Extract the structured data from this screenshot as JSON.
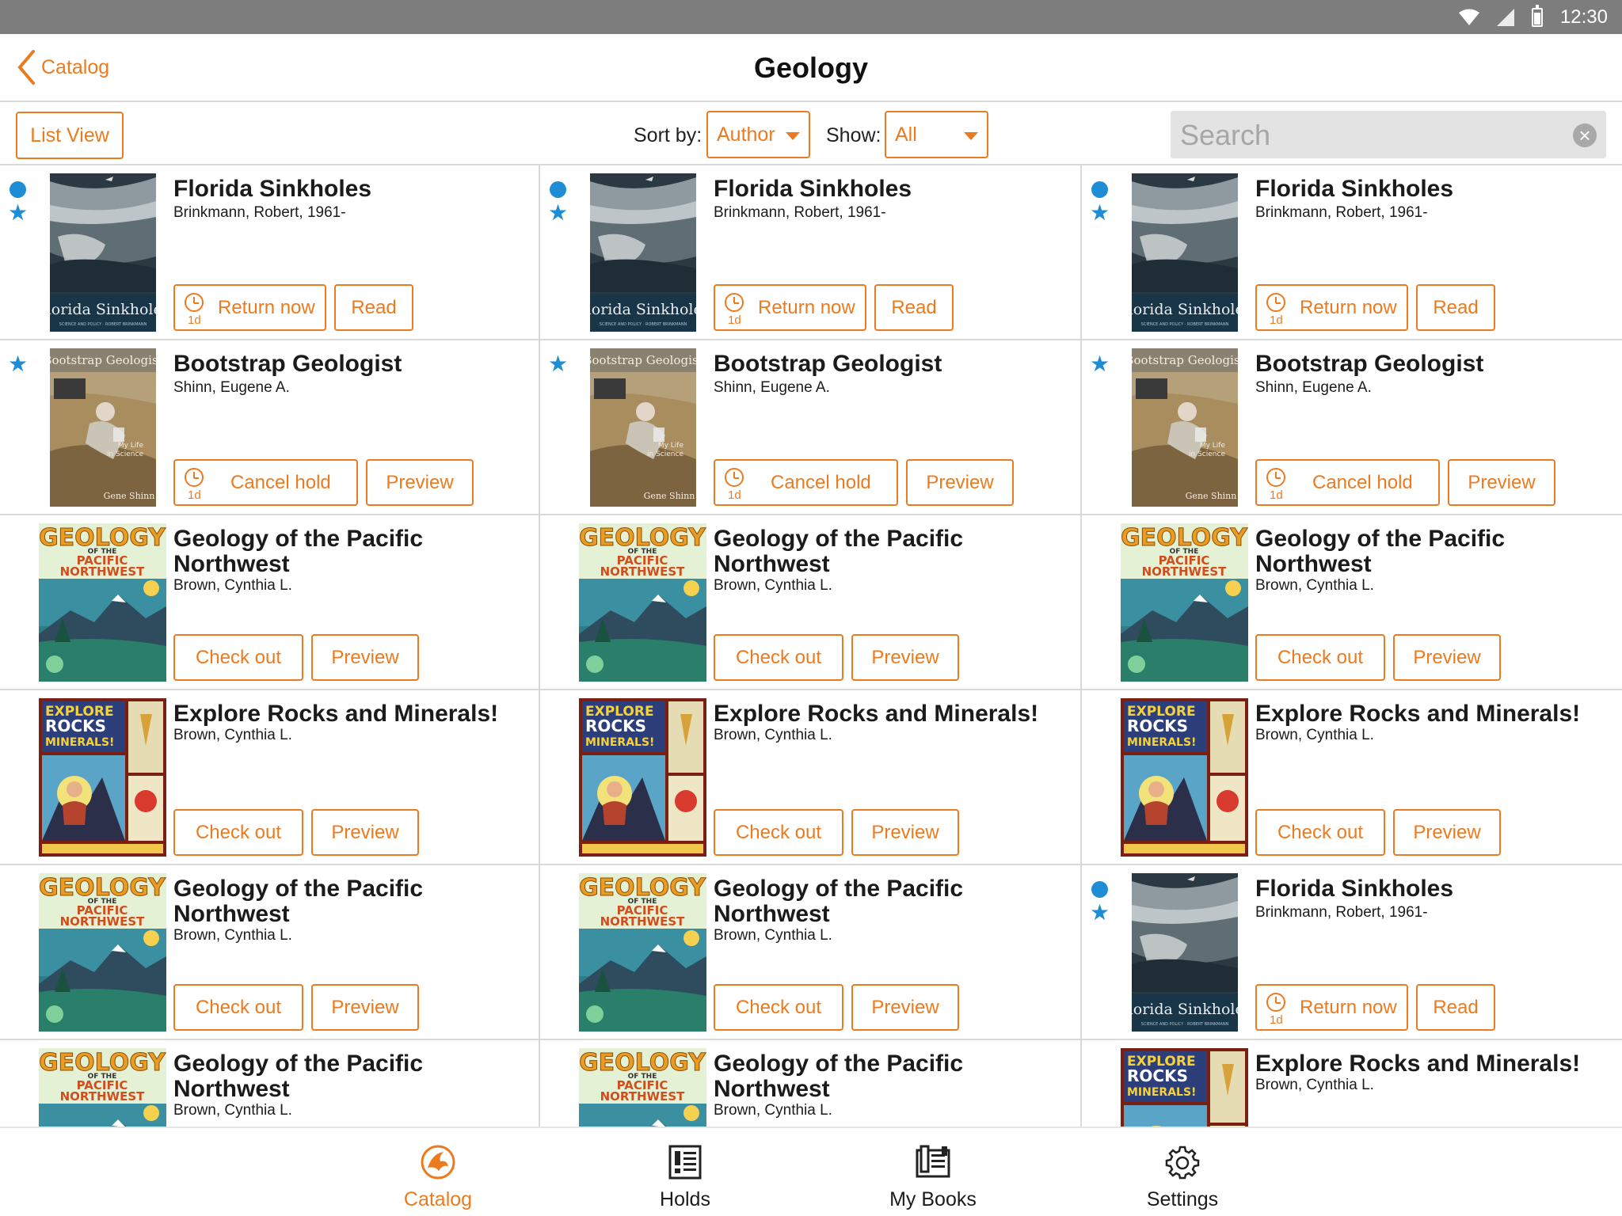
{
  "status": {
    "time": "12:30"
  },
  "nav": {
    "back_label": "Catalog",
    "title": "Geology"
  },
  "toolbar": {
    "list_view": "List View",
    "sort_label": "Sort by:",
    "sort_value": "Author",
    "show_label": "Show:",
    "show_value": "All",
    "search_placeholder": "Search"
  },
  "books": [
    {
      "title": "Florida Sinkholes",
      "author": "Brinkmann, Robert, 1961-",
      "cover": "sinkholes",
      "dot": true,
      "star": true,
      "primary": "Return now",
      "timed": true,
      "timer": "1d",
      "secondary": "Read"
    },
    {
      "title": "Florida Sinkholes",
      "author": "Brinkmann, Robert, 1961-",
      "cover": "sinkholes",
      "dot": true,
      "star": true,
      "primary": "Return now",
      "timed": true,
      "timer": "1d",
      "secondary": "Read"
    },
    {
      "title": "Florida Sinkholes",
      "author": "Brinkmann, Robert, 1961-",
      "cover": "sinkholes",
      "dot": true,
      "star": true,
      "primary": "Return now",
      "timed": true,
      "timer": "1d",
      "secondary": "Read"
    },
    {
      "title": "Bootstrap Geologist",
      "author": "Shinn, Eugene A.",
      "cover": "bootstrap",
      "dot": false,
      "star": true,
      "primary": "Cancel hold",
      "timed": true,
      "timer": "1d",
      "secondary": "Preview"
    },
    {
      "title": "Bootstrap Geologist",
      "author": "Shinn, Eugene A.",
      "cover": "bootstrap",
      "dot": false,
      "star": true,
      "primary": "Cancel hold",
      "timed": true,
      "timer": "1d",
      "secondary": "Preview"
    },
    {
      "title": "Bootstrap Geologist",
      "author": "Shinn, Eugene A.",
      "cover": "bootstrap",
      "dot": false,
      "star": true,
      "primary": "Cancel hold",
      "timed": true,
      "timer": "1d",
      "secondary": "Preview"
    },
    {
      "title": "Geology of the Pacific Northwest",
      "author": "Brown, Cynthia L.",
      "cover": "pacific",
      "dot": false,
      "star": false,
      "primary": "Check out",
      "timed": false,
      "secondary": "Preview"
    },
    {
      "title": "Geology of the Pacific Northwest",
      "author": "Brown, Cynthia L.",
      "cover": "pacific",
      "dot": false,
      "star": false,
      "primary": "Check out",
      "timed": false,
      "secondary": "Preview"
    },
    {
      "title": "Geology of the Pacific Northwest",
      "author": "Brown, Cynthia L.",
      "cover": "pacific",
      "dot": false,
      "star": false,
      "primary": "Check out",
      "timed": false,
      "secondary": "Preview"
    },
    {
      "title": "Explore Rocks and Minerals!",
      "author": "Brown, Cynthia L.",
      "cover": "rocks",
      "dot": false,
      "star": false,
      "primary": "Check out",
      "timed": false,
      "secondary": "Preview"
    },
    {
      "title": "Explore Rocks and Minerals!",
      "author": "Brown, Cynthia L.",
      "cover": "rocks",
      "dot": false,
      "star": false,
      "primary": "Check out",
      "timed": false,
      "secondary": "Preview"
    },
    {
      "title": "Explore Rocks and Minerals!",
      "author": "Brown, Cynthia L.",
      "cover": "rocks",
      "dot": false,
      "star": false,
      "primary": "Check out",
      "timed": false,
      "secondary": "Preview"
    },
    {
      "title": "Geology of the Pacific Northwest",
      "author": "Brown, Cynthia L.",
      "cover": "pacific",
      "dot": false,
      "star": false,
      "primary": "Check out",
      "timed": false,
      "secondary": "Preview"
    },
    {
      "title": "Geology of the Pacific Northwest",
      "author": "Brown, Cynthia L.",
      "cover": "pacific",
      "dot": false,
      "star": false,
      "primary": "Check out",
      "timed": false,
      "secondary": "Preview"
    },
    {
      "title": "Florida Sinkholes",
      "author": "Brinkmann, Robert, 1961-",
      "cover": "sinkholes",
      "dot": true,
      "star": true,
      "primary": "Return now",
      "timed": true,
      "timer": "1d",
      "secondary": "Read"
    },
    {
      "title": "Geology of the Pacific Northwest",
      "author": "Brown, Cynthia L.",
      "cover": "pacific",
      "dot": false,
      "star": false,
      "primary": "",
      "timed": false,
      "secondary": ""
    },
    {
      "title": "Geology of the Pacific Northwest",
      "author": "Brown, Cynthia L.",
      "cover": "pacific",
      "dot": false,
      "star": false,
      "primary": "",
      "timed": false,
      "secondary": ""
    },
    {
      "title": "Explore Rocks and Minerals!",
      "author": "Brown, Cynthia L.",
      "cover": "rocks",
      "dot": false,
      "star": false,
      "primary": "",
      "timed": false,
      "secondary": ""
    }
  ],
  "cover_art": {
    "sinkholes": {
      "title": "Florida Sinkholes",
      "subtitle": "SCIENCE AND POLICY · ROBERT BRINKMANN"
    },
    "bootstrap": {
      "title": "Bootstrap Geologist",
      "subtitle": "My Life in Science",
      "author": "Gene Shinn"
    },
    "pacific": {
      "line1": "GEOLOGY",
      "line2": "OF THE",
      "line3": "PACIFIC",
      "line4": "NORTHWEST"
    },
    "rocks": {
      "line1": "EXPLORE",
      "line2": "ROCKS",
      "line3": "MINERALS!"
    }
  },
  "tabs": [
    {
      "label": "Catalog",
      "icon": "catalog-icon",
      "active": true
    },
    {
      "label": "Holds",
      "icon": "holds-icon",
      "active": false
    },
    {
      "label": "My Books",
      "icon": "my-books-icon",
      "active": false
    },
    {
      "label": "Settings",
      "icon": "settings-icon",
      "active": false
    }
  ],
  "colors": {
    "accent": "#ec7a1f",
    "badge": "#1f8cd6",
    "statusbar": "#7d7d7d"
  }
}
